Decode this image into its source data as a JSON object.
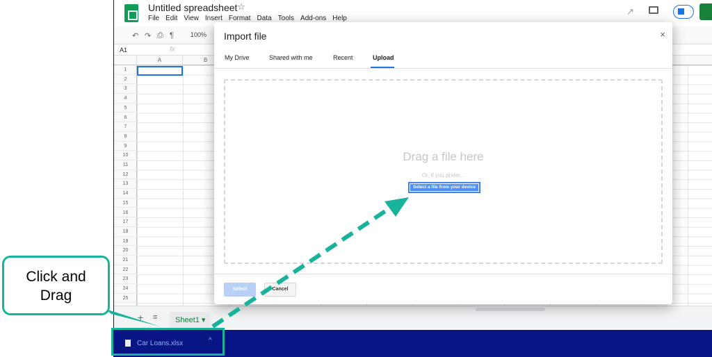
{
  "sheets_app": {
    "doc_title": "Untitled spreadsheet",
    "menu": [
      "File",
      "Edit",
      "View",
      "Insert",
      "Format",
      "Data",
      "Tools",
      "Add-ons",
      "Help"
    ],
    "zoom": "100%",
    "name_box": "A1",
    "fx_label": "fx",
    "columns": [
      "A",
      "B"
    ],
    "rows": [
      "1",
      "2",
      "3",
      "4",
      "5",
      "6",
      "7",
      "8",
      "9",
      "10",
      "11",
      "12",
      "13",
      "14",
      "15",
      "16",
      "17",
      "18",
      "19",
      "20",
      "21",
      "22",
      "23",
      "24",
      "25"
    ],
    "sheet_tab": "Sheet1"
  },
  "download_bar": {
    "file_name": "Car Loans.xlsx",
    "chevron": "^"
  },
  "modal": {
    "title": "Import file",
    "close_glyph": "×",
    "tabs": [
      {
        "label": "My Drive"
      },
      {
        "label": "Shared with me"
      },
      {
        "label": "Recent"
      },
      {
        "label": "Upload"
      }
    ],
    "active_tab": "Upload",
    "drop_text": "Drag a file here",
    "prefer_text": "Or, if you prefer...",
    "select_device_label": "Select a file from your device",
    "select_label": "Select",
    "cancel_label": "Cancel"
  },
  "annotation": {
    "callout_line1": "Click and",
    "callout_line2": "Drag",
    "accent_color": "#19b39b"
  },
  "colors": {
    "download_bar": "#0a1585",
    "primary_blue": "#4d90fe",
    "sheets_green": "#0f9d58"
  }
}
